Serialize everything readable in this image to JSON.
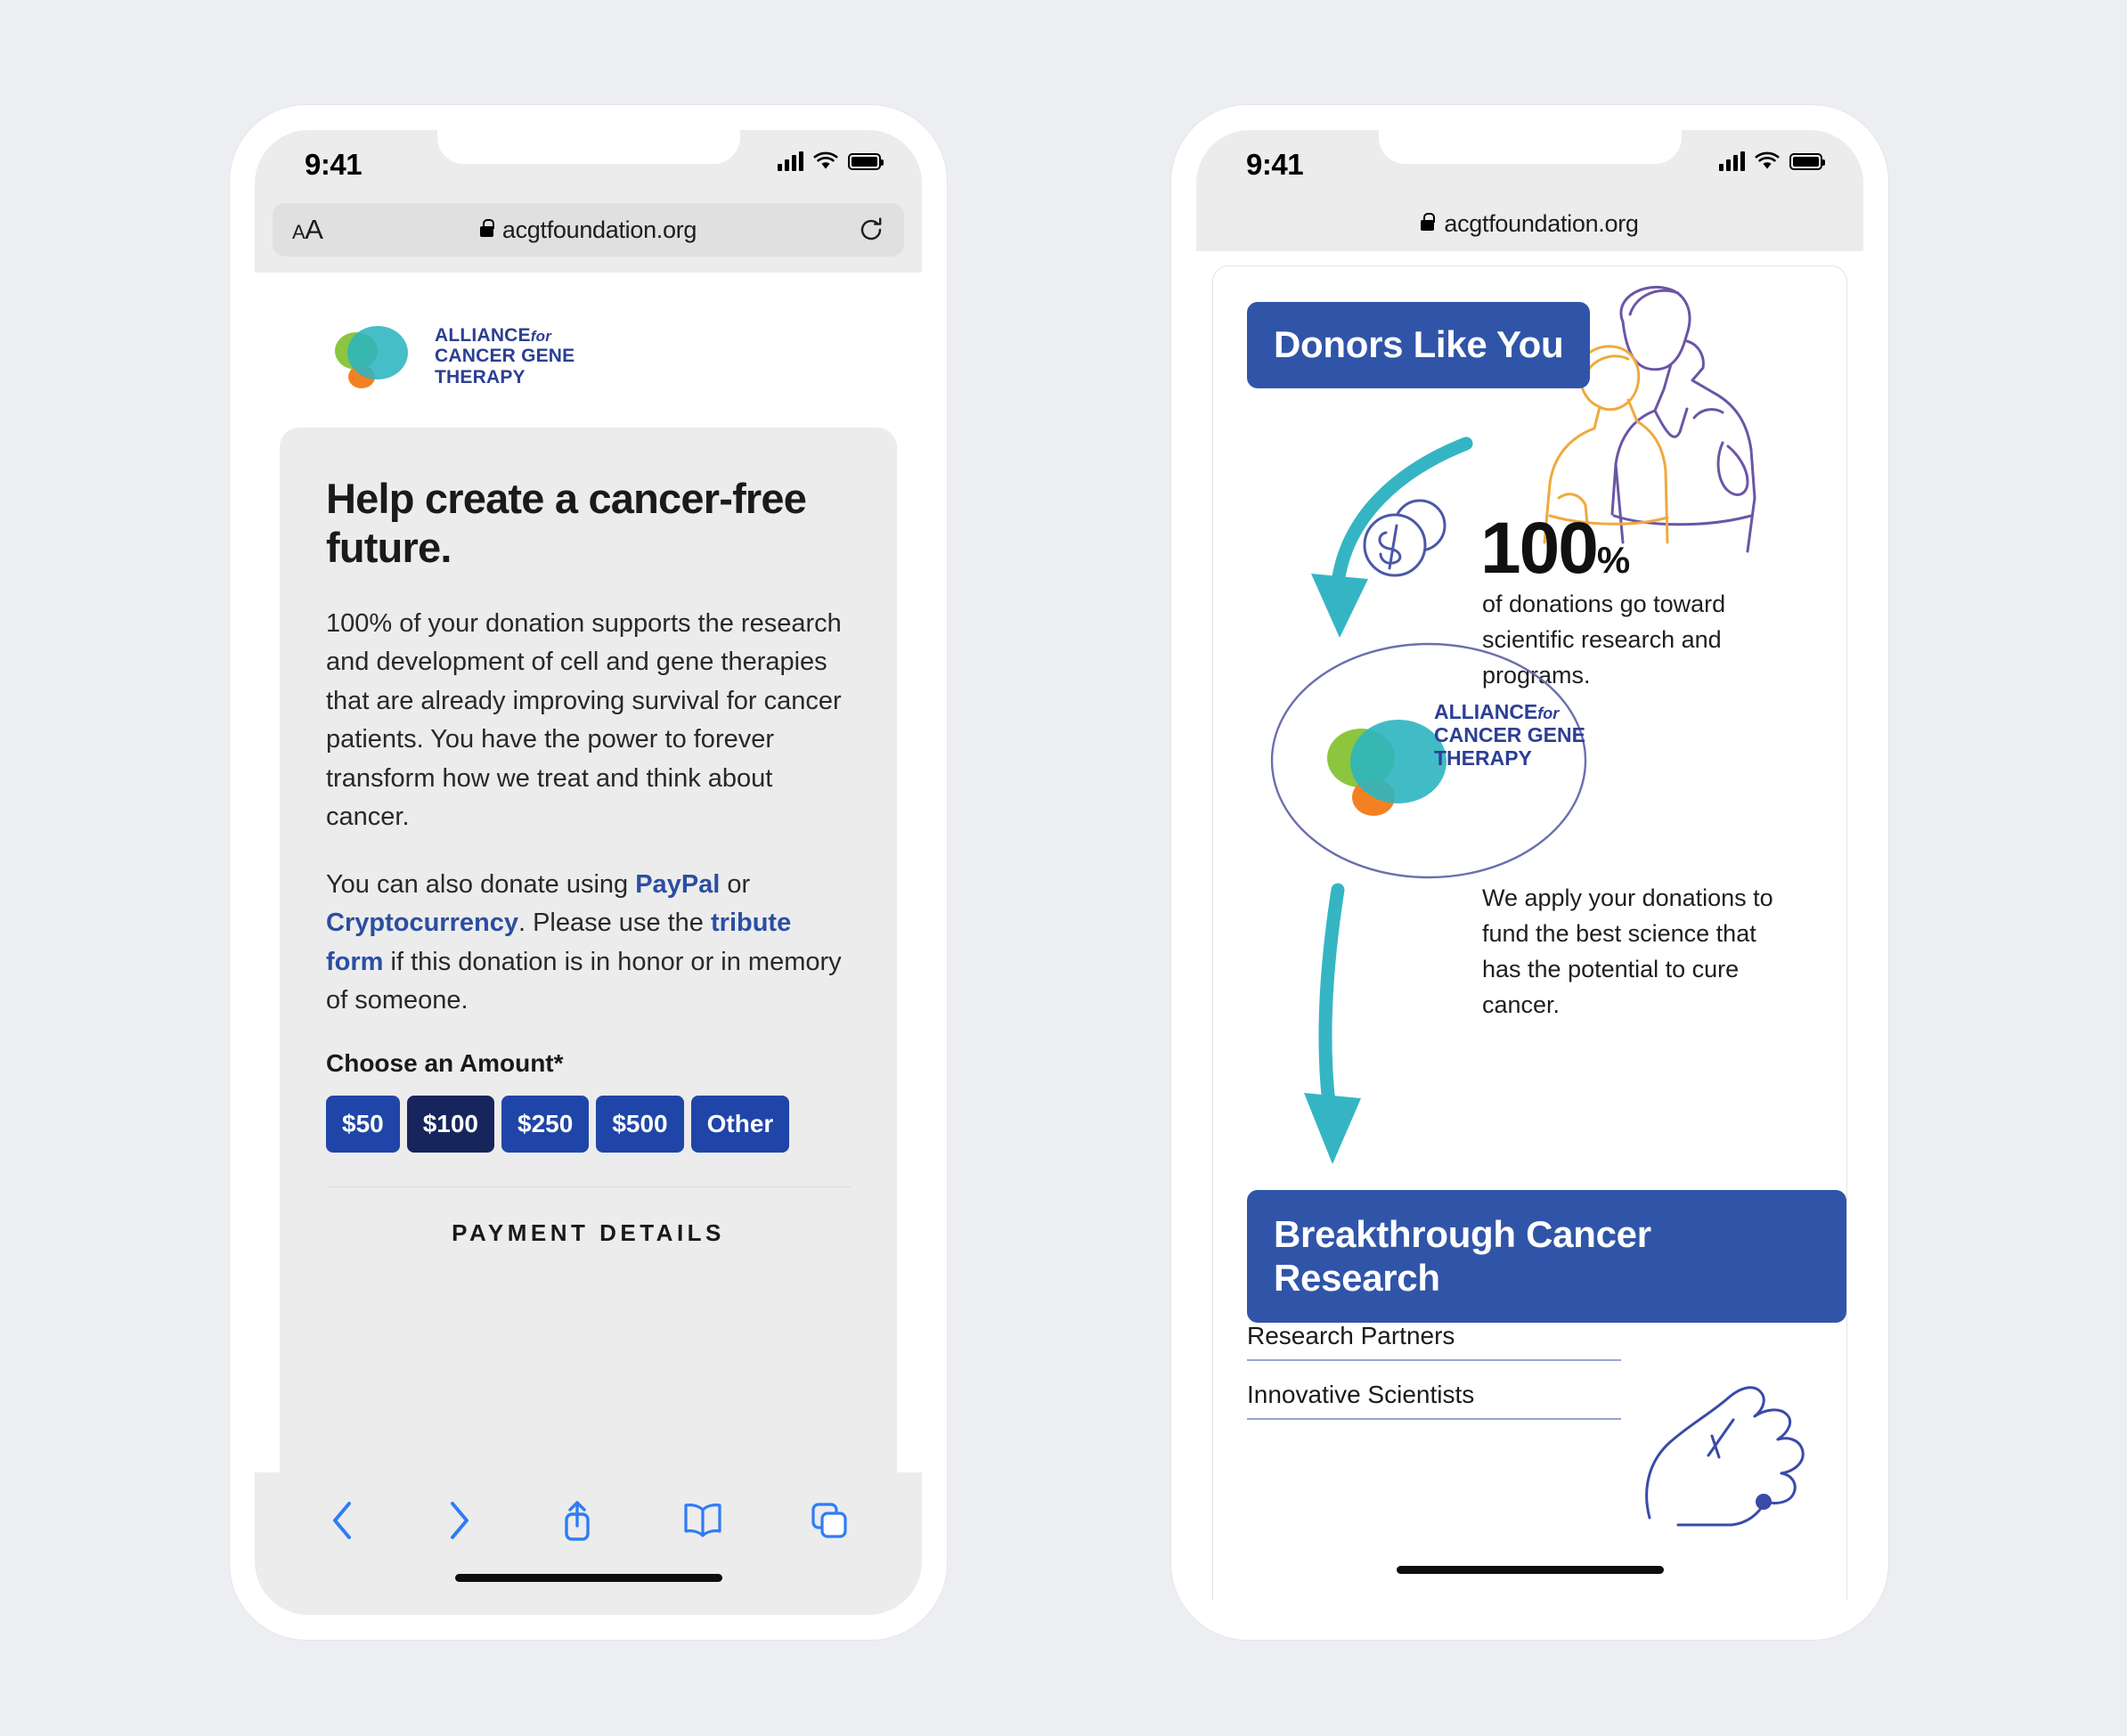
{
  "accent": {
    "brand_blue": "#2b3f94",
    "button_blue": "#2045a8",
    "button_blue_selected": "#16265c",
    "pill_blue": "#3055a8",
    "teal": "#35b5c4",
    "link_blue": "#2b4ea2",
    "logo_green": "#8cc63f",
    "logo_teal": "#2cb5c0",
    "logo_orange": "#f48121",
    "purple_line": "#6b55a6",
    "orange_line": "#f0a93c"
  },
  "left_phone": {
    "status": {
      "time": "9:41"
    },
    "browser": {
      "text_size_icon": "aA",
      "lock_icon": "lock-icon",
      "url": "acgtfoundation.org",
      "reload_icon": "reload-icon"
    },
    "logo": {
      "line1": "ALLIANCE",
      "line1_italic": "for",
      "line2": "CANCER GENE",
      "line3": "THERAPY"
    },
    "content": {
      "headline": "Help create a cancer-free future.",
      "paragraph1": "100% of your donation supports the research and development of cell and gene therapies that are already improving survival for cancer patients. You have the power to forever transform how we treat and think about cancer.",
      "paragraph2_parts": {
        "t1": "You can also donate using ",
        "link1": "PayPal",
        "t2": " or ",
        "link2": "Cryptocurrency",
        "t3": ". Please use the ",
        "link3": "tribute form",
        "t4": " if this donation is in honor or in memory of someone."
      },
      "amount_label": "Choose an Amount*",
      "amounts": [
        {
          "label": "$50",
          "selected": false
        },
        {
          "label": "$100",
          "selected": true
        },
        {
          "label": "$250",
          "selected": false
        },
        {
          "label": "$500",
          "selected": false
        },
        {
          "label": "Other",
          "selected": false
        }
      ],
      "payment_details_title": "PAYMENT DETAILS"
    },
    "toolbar": {
      "back": "back-icon",
      "forward": "forward-icon",
      "share": "share-icon",
      "bookmarks": "bookmarks-icon",
      "tabs": "tabs-icon"
    }
  },
  "right_phone": {
    "status": {
      "time": "9:41"
    },
    "browser": {
      "lock_icon": "lock-icon",
      "url": "acgtfoundation.org"
    },
    "infographic": {
      "pill_donors": "Donors Like You",
      "stat_number": "100",
      "stat_percent": "%",
      "stat_description": "of donations go toward scientific research and programs.",
      "logo": {
        "line1": "ALLIANCE",
        "line1_italic": "for",
        "line2": "CANCER GENE",
        "line3": "THERAPY"
      },
      "apply_description": "We apply your donations to fund the best science that has the potential to cure cancer.",
      "pill_breakthrough": "Breakthrough Cancer Research",
      "list": [
        "Research Partners",
        "Innovative Scientists"
      ],
      "illustration_people": "people-line-art-illustration",
      "illustration_coin": "dollar-coin-icon",
      "illustration_hand": "hand-line-art-icon"
    }
  }
}
